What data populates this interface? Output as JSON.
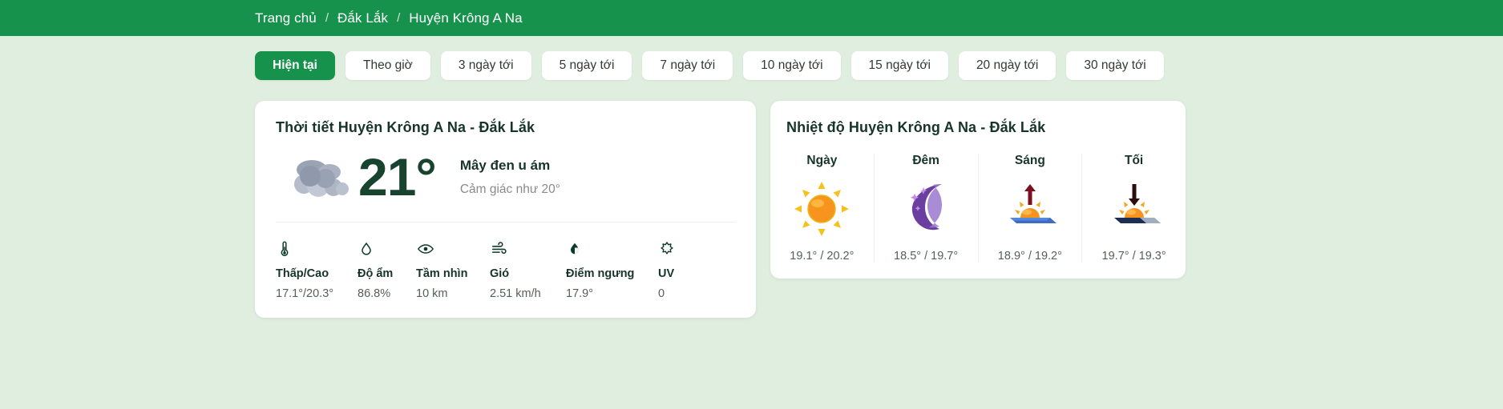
{
  "breadcrumb": {
    "items": [
      {
        "label": "Trang chủ"
      },
      {
        "label": "Đắk Lắk"
      },
      {
        "label": "Huyện Krông A Na"
      }
    ],
    "separator": "/"
  },
  "tabs": [
    {
      "label": "Hiện tại",
      "active": true
    },
    {
      "label": "Theo giờ",
      "active": false
    },
    {
      "label": "3 ngày tới",
      "active": false
    },
    {
      "label": "5 ngày tới",
      "active": false
    },
    {
      "label": "7 ngày tới",
      "active": false
    },
    {
      "label": "10 ngày tới",
      "active": false
    },
    {
      "label": "15 ngày tới",
      "active": false
    },
    {
      "label": "20 ngày tới",
      "active": false
    },
    {
      "label": "30 ngày tới",
      "active": false
    }
  ],
  "current_card": {
    "title": "Thời tiết Huyện Krông A Na - Đắk Lắk",
    "icon": "dark-clouds-icon",
    "temperature": "21°",
    "condition": "Mây đen u ám",
    "feels_like": "Cảm giác như 20°",
    "metrics": [
      {
        "icon": "thermometer-icon",
        "label": "Thấp/Cao",
        "value": "17.1°/20.3°"
      },
      {
        "icon": "humidity-drop-icon",
        "label": "Độ ẩm",
        "value": "86.8%"
      },
      {
        "icon": "eye-icon",
        "label": "Tầm nhìn",
        "value": "10 km"
      },
      {
        "icon": "wind-icon",
        "label": "Gió",
        "value": "2.51 km/h"
      },
      {
        "icon": "dew-point-icon",
        "label": "Điểm ngưng",
        "value": "17.9°"
      },
      {
        "icon": "uv-sun-icon",
        "label": "UV",
        "value": "0"
      }
    ]
  },
  "temperature_card": {
    "title": "Nhiệt độ Huyện Krông A Na - Đắk Lắk",
    "columns": [
      {
        "header": "Ngày",
        "icon": "sun-icon",
        "value": "19.1° / 20.2°"
      },
      {
        "header": "Đêm",
        "icon": "crescent-moon-stars-icon",
        "value": "18.5° / 19.7°"
      },
      {
        "header": "Sáng",
        "icon": "sunrise-icon",
        "value": "18.9° / 19.2°"
      },
      {
        "header": "Tối",
        "icon": "sunset-icon",
        "value": "19.7° / 19.3°"
      }
    ]
  },
  "colors": {
    "brand_green": "#17924c",
    "page_background": "#dfeedf",
    "card_background": "#ffffff",
    "temp_text": "#17432f"
  }
}
